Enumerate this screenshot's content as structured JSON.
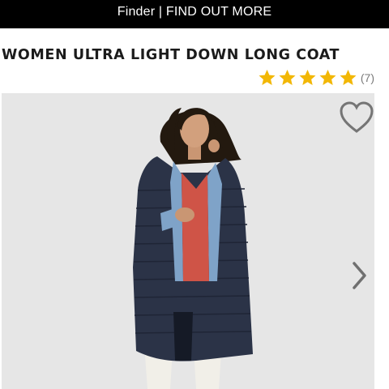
{
  "banner": {
    "text": "Finder | FIND OUT MORE"
  },
  "product": {
    "title": "WOMEN ULTRA LIGHT DOWN LONG COAT",
    "rating": 5,
    "review_count": "(7)"
  },
  "icons": {
    "star": "star-icon",
    "favorite": "heart-outline-icon",
    "next": "chevron-right-icon"
  },
  "colors": {
    "banner_bg": "#000000",
    "star": "#f2b705",
    "coat": "#2b3347"
  }
}
